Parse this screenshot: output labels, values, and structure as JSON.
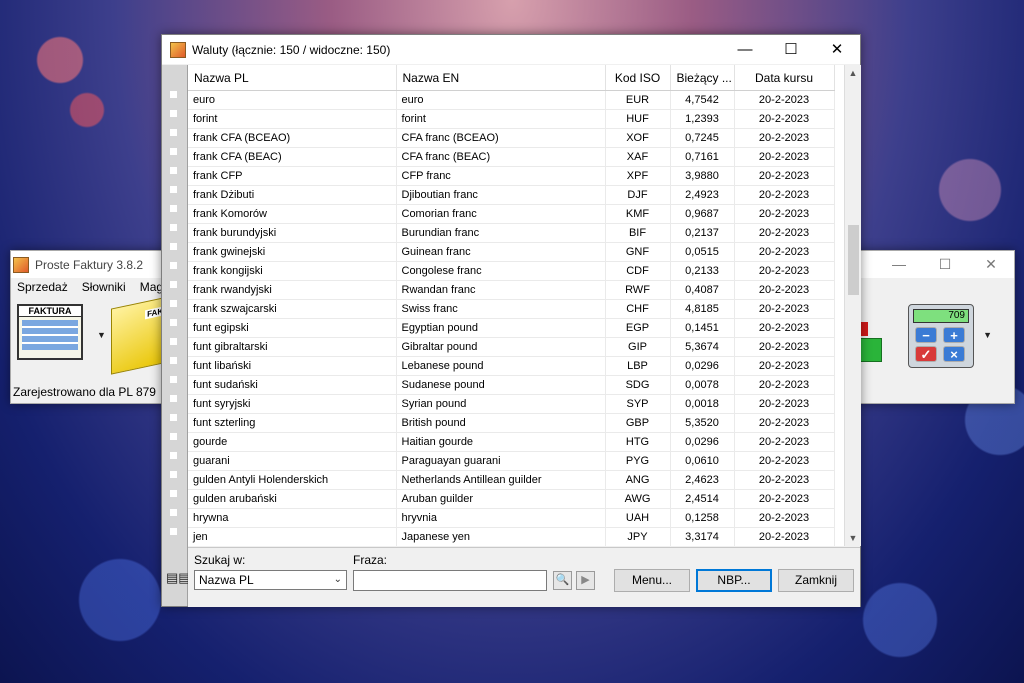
{
  "background_app": {
    "title": "Proste Faktury 3.8.2",
    "menu": [
      "Sprzedaż",
      "Słowniki",
      "Mag"
    ],
    "status": "Zarejestrowano dla PL 879",
    "invoice_icon_label": "FAKTURA",
    "folder_icon_label": "FAKT",
    "calc_display": "709"
  },
  "dialog": {
    "title": "Waluty (łącznie: 150 / widoczne: 150)",
    "columns": [
      "Nazwa PL",
      "Nazwa EN",
      "Kod ISO",
      "Bieżący ...",
      "Data kursu"
    ],
    "rows": [
      [
        "euro",
        "euro",
        "EUR",
        "4,7542",
        "20-2-2023"
      ],
      [
        "forint",
        "forint",
        "HUF",
        "1,2393",
        "20-2-2023"
      ],
      [
        "frank CFA (BCEAO)",
        "CFA franc (BCEAO)",
        "XOF",
        "0,7245",
        "20-2-2023"
      ],
      [
        "frank CFA (BEAC)",
        "CFA franc (BEAC)",
        "XAF",
        "0,7161",
        "20-2-2023"
      ],
      [
        "frank CFP",
        "CFP franc",
        "XPF",
        "3,9880",
        "20-2-2023"
      ],
      [
        "frank Dżibuti",
        "Djiboutian franc",
        "DJF",
        "2,4923",
        "20-2-2023"
      ],
      [
        "frank Komorów",
        "Comorian franc",
        "KMF",
        "0,9687",
        "20-2-2023"
      ],
      [
        "frank burundyjski",
        "Burundian franc",
        "BIF",
        "0,2137",
        "20-2-2023"
      ],
      [
        "frank gwinejski",
        "Guinean franc",
        "GNF",
        "0,0515",
        "20-2-2023"
      ],
      [
        "frank kongijski",
        "Congolese franc",
        "CDF",
        "0,2133",
        "20-2-2023"
      ],
      [
        "frank rwandyjski",
        "Rwandan franc",
        "RWF",
        "0,4087",
        "20-2-2023"
      ],
      [
        "frank szwajcarski",
        "Swiss franc",
        "CHF",
        "4,8185",
        "20-2-2023"
      ],
      [
        "funt egipski",
        "Egyptian pound",
        "EGP",
        "0,1451",
        "20-2-2023"
      ],
      [
        "funt gibraltarski",
        "Gibraltar pound",
        "GIP",
        "5,3674",
        "20-2-2023"
      ],
      [
        "funt libański",
        "Lebanese pound",
        "LBP",
        "0,0296",
        "20-2-2023"
      ],
      [
        "funt sudański",
        "Sudanese pound",
        "SDG",
        "0,0078",
        "20-2-2023"
      ],
      [
        "funt syryjski",
        "Syrian pound",
        "SYP",
        "0,0018",
        "20-2-2023"
      ],
      [
        "funt szterling",
        "British pound",
        "GBP",
        "5,3520",
        "20-2-2023"
      ],
      [
        "gourde",
        "Haitian gourde",
        "HTG",
        "0,0296",
        "20-2-2023"
      ],
      [
        "guarani",
        "Paraguayan guarani",
        "PYG",
        "0,0610",
        "20-2-2023"
      ],
      [
        "gulden Antyli Holenderskich",
        "Netherlands Antillean guilder",
        "ANG",
        "2,4623",
        "20-2-2023"
      ],
      [
        "gulden arubański",
        "Aruban guilder",
        "AWG",
        "2,4514",
        "20-2-2023"
      ],
      [
        "hrywna",
        "hryvnia",
        "UAH",
        "0,1258",
        "20-2-2023"
      ],
      [
        "jen",
        "Japanese yen",
        "JPY",
        "3,3174",
        "20-2-2023"
      ]
    ],
    "search": {
      "search_in_label": "Szukaj w:",
      "search_in_value": "Nazwa PL",
      "phrase_label": "Fraza:",
      "phrase_value": ""
    },
    "buttons": {
      "menu": "Menu...",
      "nbp": "NBP...",
      "close": "Zamknij"
    }
  }
}
